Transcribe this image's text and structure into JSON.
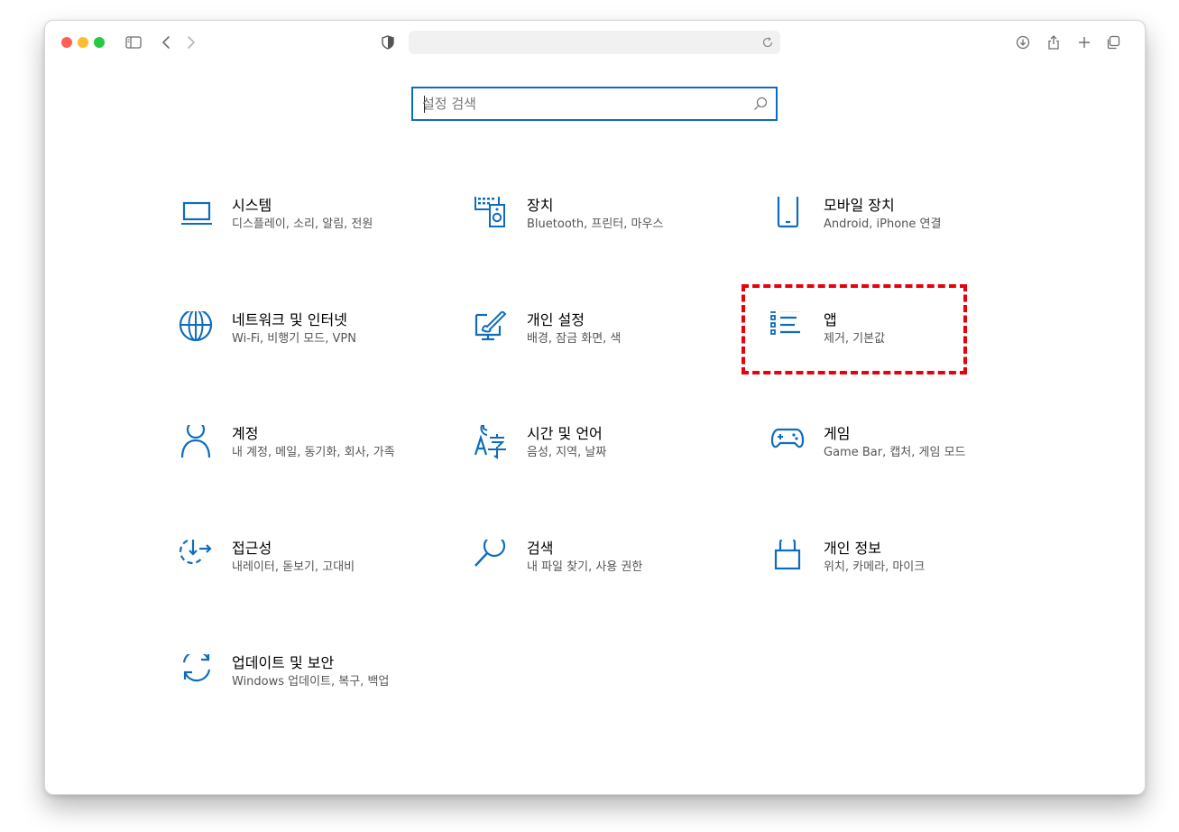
{
  "search": {
    "placeholder": "설정 검색"
  },
  "colors": {
    "accent": "#0f6cbd",
    "highlight": "#e8000b"
  },
  "tiles": [
    {
      "title": "시스템",
      "desc": "디스플레이, 소리, 알림, 전원",
      "icon": "laptop-icon"
    },
    {
      "title": "장치",
      "desc": "Bluetooth, 프린터, 마우스",
      "icon": "keyboard-speaker-icon"
    },
    {
      "title": "모바일 장치",
      "desc": "Android, iPhone 연결",
      "icon": "phone-icon"
    },
    {
      "title": "네트워크 및 인터넷",
      "desc": "Wi-Fi, 비행기 모드, VPN",
      "icon": "globe-icon"
    },
    {
      "title": "개인 설정",
      "desc": "배경, 잠금 화면, 색",
      "icon": "brush-monitor-icon"
    },
    {
      "title": "앱",
      "desc": "제거, 기본값",
      "icon": "apps-list-icon"
    },
    {
      "title": "계정",
      "desc": "내 계정, 메일, 동기화, 회사, 가족",
      "icon": "person-icon"
    },
    {
      "title": "시간 및 언어",
      "desc": "음성, 지역, 날짜",
      "icon": "time-language-icon"
    },
    {
      "title": "게임",
      "desc": "Game Bar, 캡처, 게임 모드",
      "icon": "gamepad-icon"
    },
    {
      "title": "접근성",
      "desc": "내레이터, 돋보기, 고대비",
      "icon": "accessibility-icon"
    },
    {
      "title": "검색",
      "desc": "내 파일 찾기, 사용 권한",
      "icon": "search-icon"
    },
    {
      "title": "개인 정보",
      "desc": "위치, 카메라, 마이크",
      "icon": "lock-icon"
    },
    {
      "title": "업데이트 및 보안",
      "desc": "Windows 업데이트, 복구, 백업",
      "icon": "sync-icon"
    }
  ]
}
